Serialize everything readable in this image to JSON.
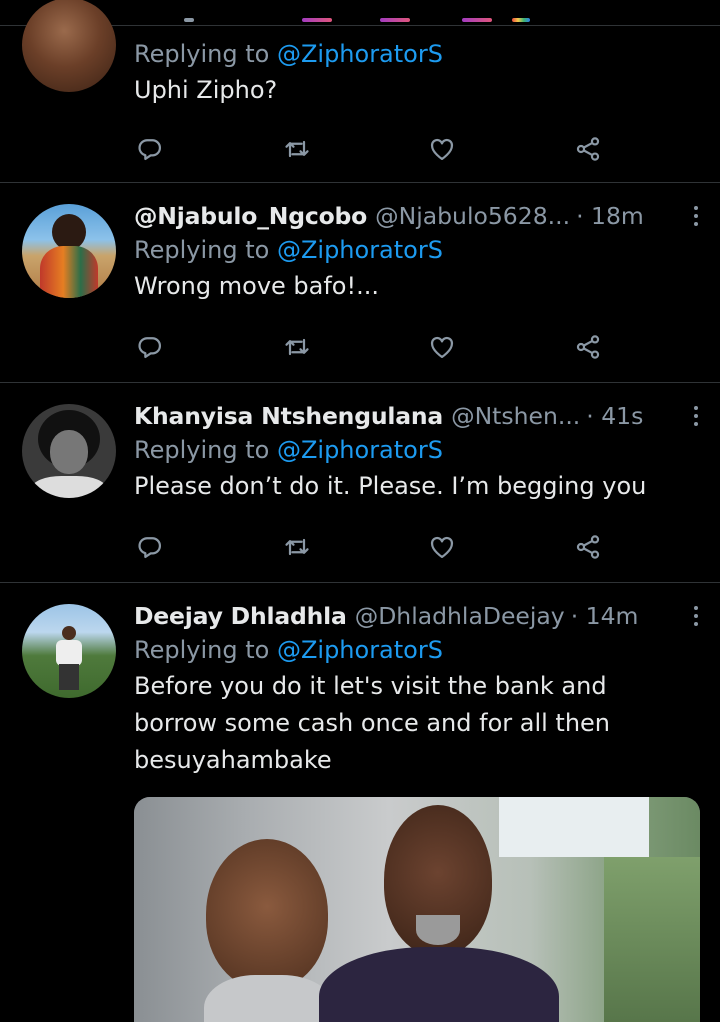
{
  "colors": {
    "background": "#000000",
    "divider": "#2f3336",
    "primary_text": "#e7e9ea",
    "secondary_text": "#8b98a5",
    "accent": "#1d9bf0"
  },
  "icons": [
    "reply-icon",
    "retweet-icon",
    "like-icon",
    "share-icon",
    "more-icon"
  ],
  "tweets": [
    {
      "reply_prefix": "Replying to",
      "reply_to": "@ZiphoratorS",
      "text": "Uphi Zipho?"
    },
    {
      "name": "@Njabulo_Ngcobo",
      "handle": "@Njabulo5628...",
      "time": "· 18m",
      "reply_prefix": "Replying to",
      "reply_to": "@ZiphoratorS",
      "text": "Wrong move bafo!..."
    },
    {
      "name": "Khanyisa Ntshengulana",
      "handle": "@Ntshen...",
      "time": "· 41s",
      "reply_prefix": "Replying to",
      "reply_to": "@ZiphoratorS",
      "text": "Please don’t do it. Please. I’m begging you"
    },
    {
      "name": "Deejay Dhladhla",
      "handle": "@DhladhlaDeejay",
      "time": "· 14m",
      "reply_prefix": "Replying to",
      "reply_to": "@ZiphoratorS",
      "text": "Before you do it let's visit the bank and borrow some cash once and for all then besuyahambake"
    }
  ]
}
